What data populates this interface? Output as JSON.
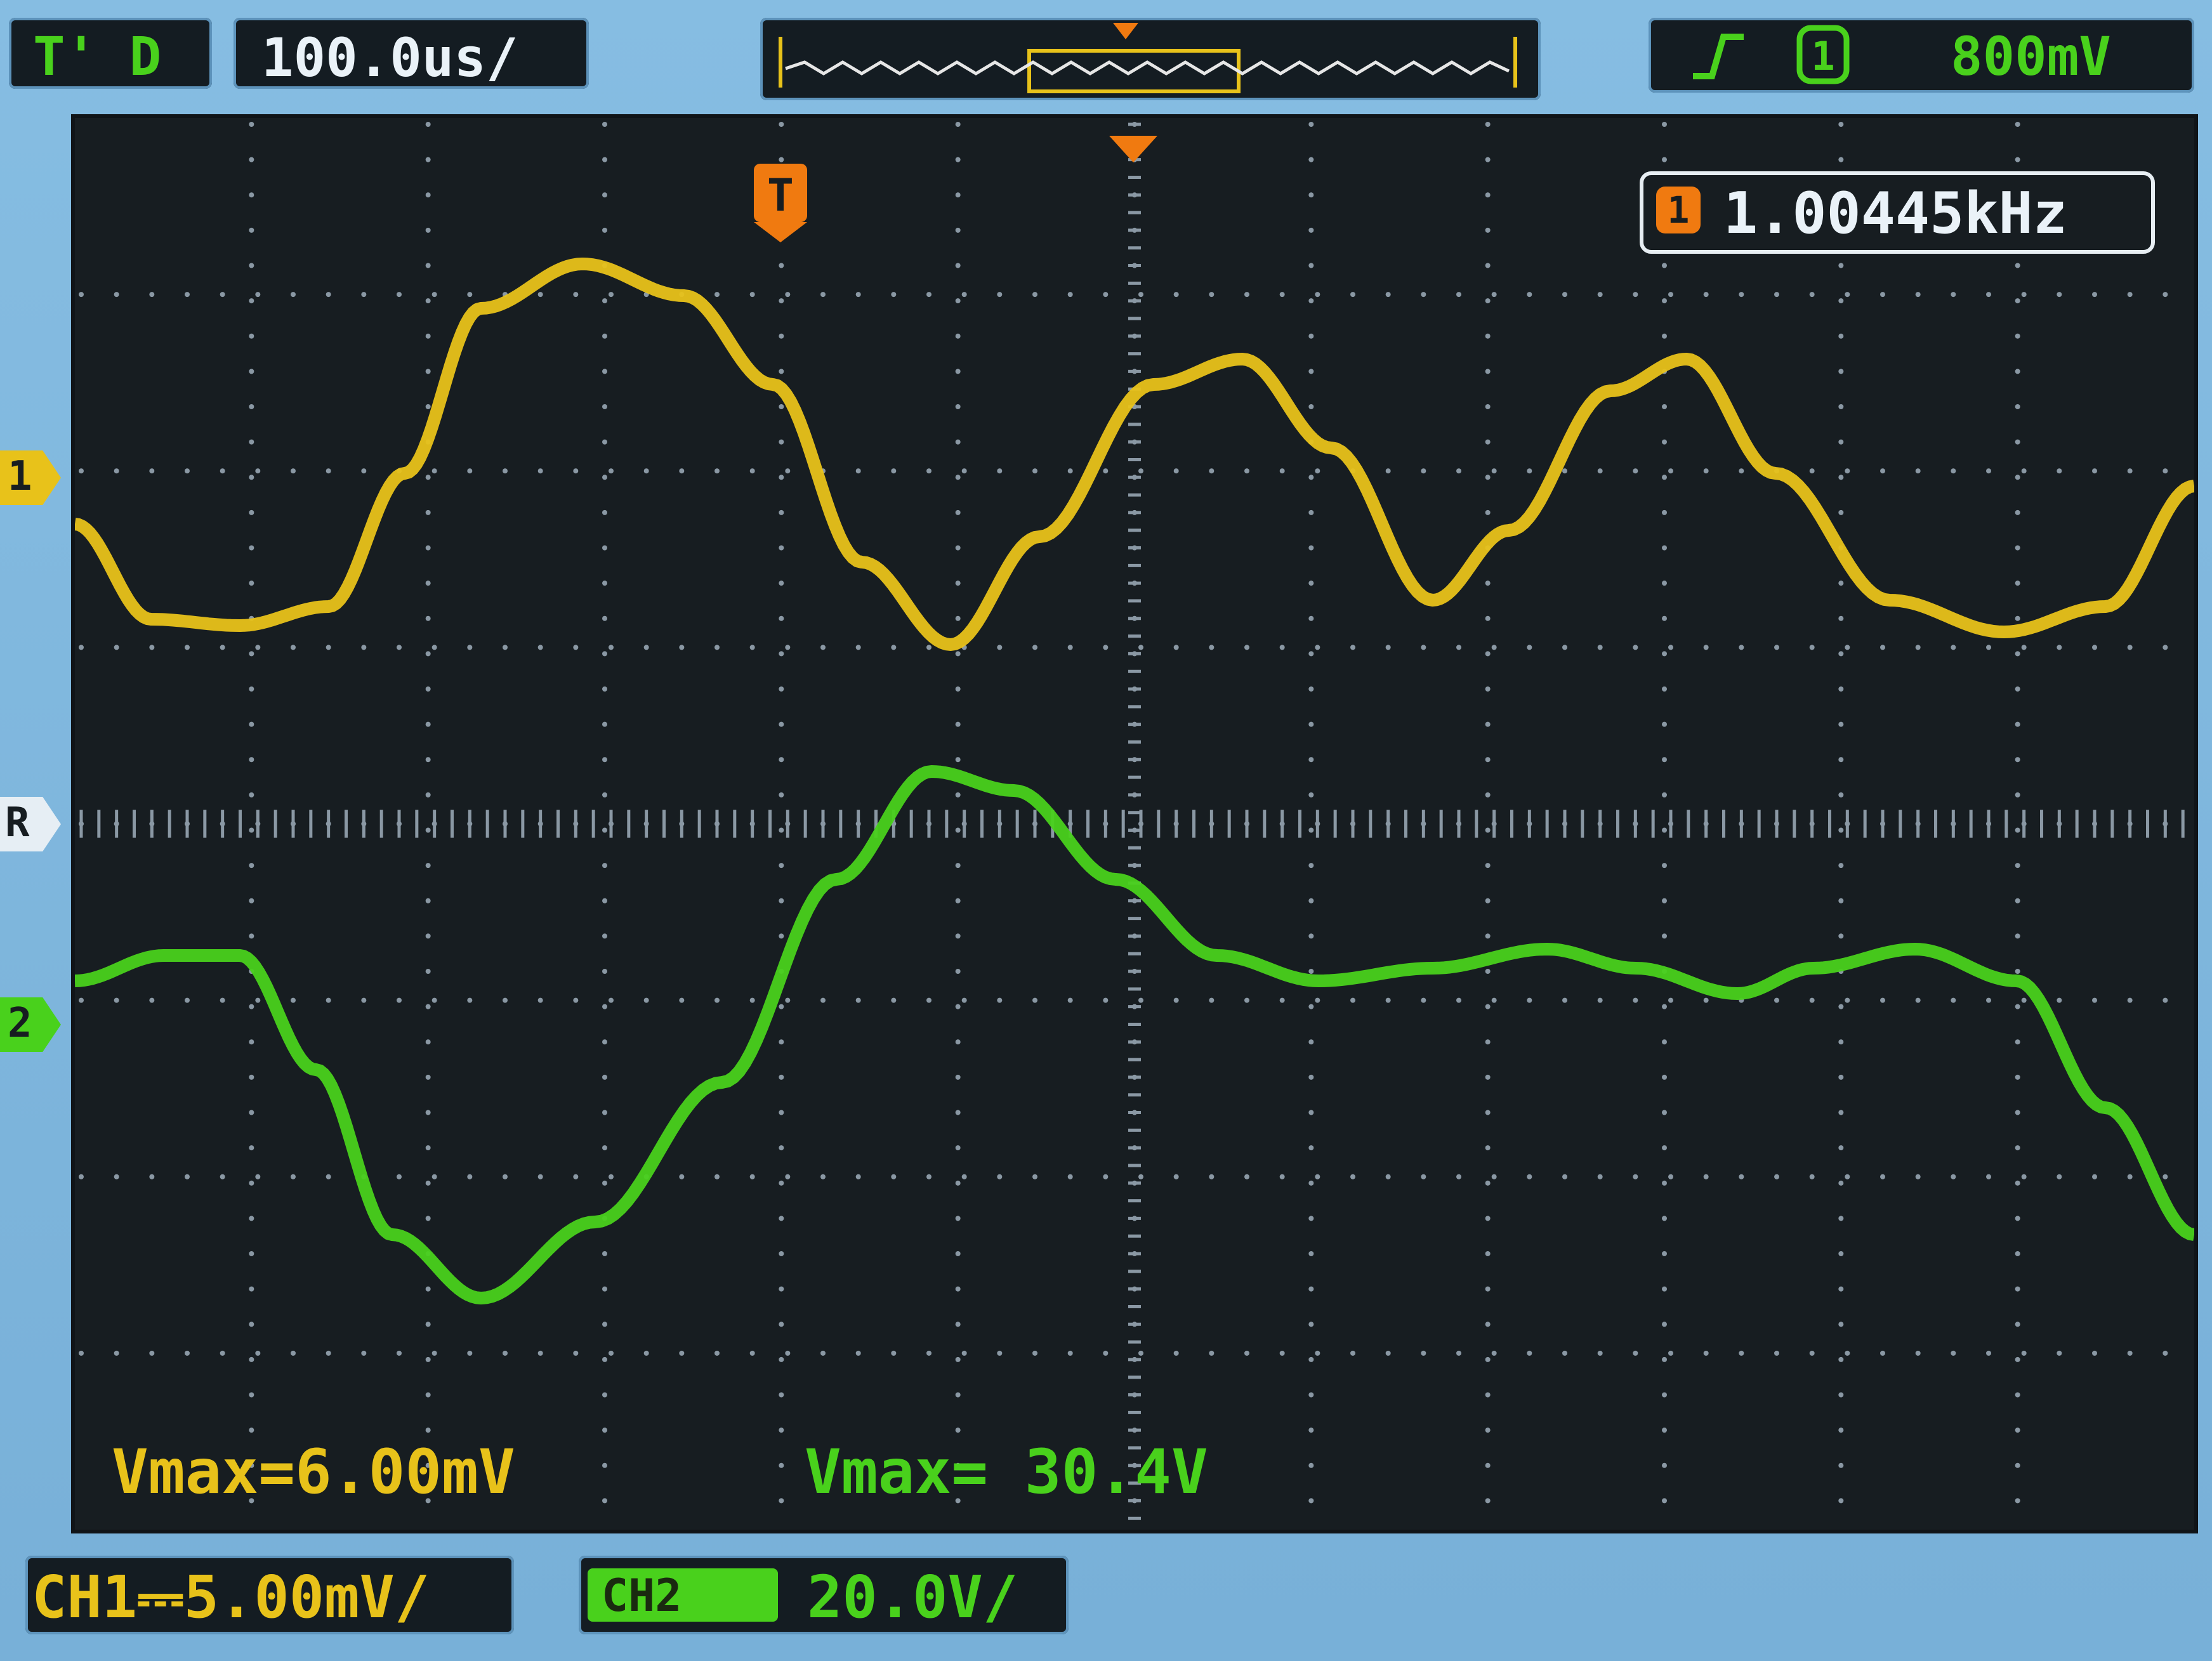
{
  "header": {
    "trigger_mode": "T' D",
    "timebase": "100.0us/",
    "trigger_level": "800mV"
  },
  "trigger_source_icon": "ch1-badge-icon",
  "trigger_slope_icon": "rising-edge-icon",
  "frequency_readout": {
    "icon": "ch1-badge-icon",
    "value": "1.00445kHz"
  },
  "markers": {
    "ch1": "1",
    "reference": "R",
    "ch2": "2"
  },
  "measurements": {
    "ch1_vmax": "Vmax=6.00mV",
    "ch2_vmax": "Vmax= 30.4V"
  },
  "footer": {
    "ch1_scale": "CH1⎓5.00mV/",
    "ch2_label": "CH2",
    "ch2_scale": "20.0V/"
  },
  "colors": {
    "ch1": "#e8c21a",
    "ch2": "#49d11c",
    "trigger": "#f07a10",
    "background": "#7fb6dc",
    "screen": "#171d21"
  }
}
